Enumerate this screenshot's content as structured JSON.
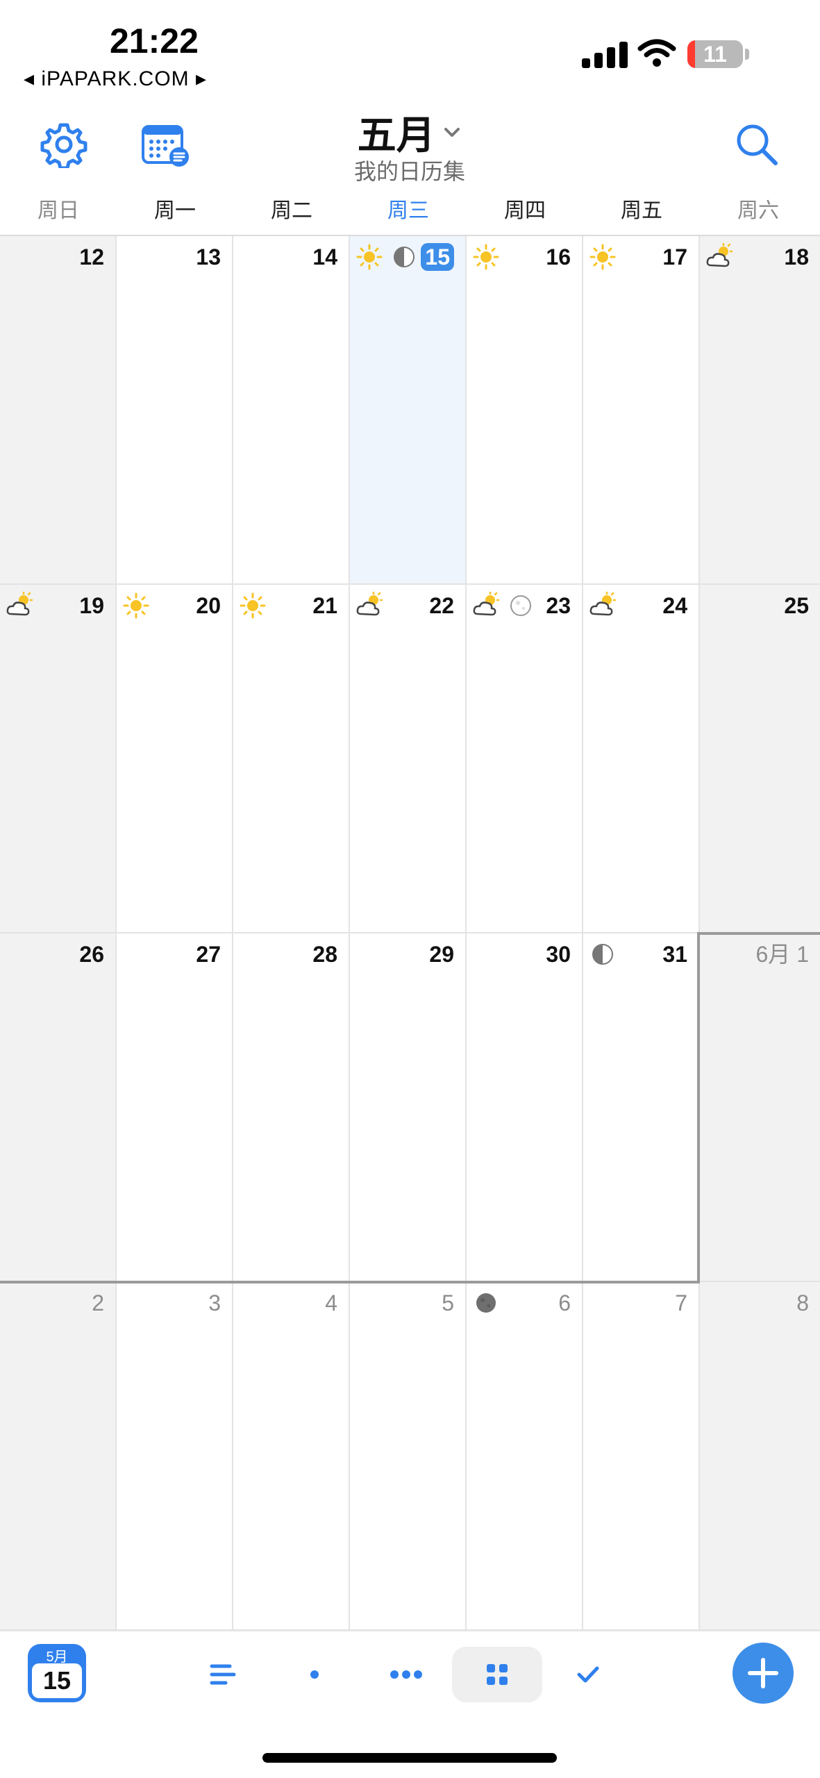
{
  "status_bar": {
    "time": "21:22",
    "back_label": "◂ iPAPARK.COM ▸",
    "battery": "11"
  },
  "header": {
    "title": "五月",
    "subtitle": "我的日历集",
    "settings_icon": "gear-icon",
    "calendars_icon": "calendar-list-icon",
    "search_icon": "search-icon"
  },
  "weekdays": [
    "周日",
    "周一",
    "周二",
    "周三",
    "周四",
    "周五",
    "周六"
  ],
  "calendar": {
    "rows": [
      [
        {
          "label": "12",
          "weekend": true
        },
        {
          "label": "13"
        },
        {
          "label": "14"
        },
        {
          "label": "15",
          "today": true,
          "icons": [
            "sun",
            "moon-half"
          ]
        },
        {
          "label": "16",
          "icons": [
            "sun"
          ]
        },
        {
          "label": "17",
          "icons": [
            "sun"
          ]
        },
        {
          "label": "18",
          "weekend": true,
          "icons": [
            "cloud-sun"
          ]
        }
      ],
      [
        {
          "label": "19",
          "weekend": true,
          "icons": [
            "cloud-sun"
          ]
        },
        {
          "label": "20",
          "icons": [
            "sun"
          ]
        },
        {
          "label": "21",
          "icons": [
            "sun"
          ]
        },
        {
          "label": "22",
          "icons": [
            "cloud-sun"
          ]
        },
        {
          "label": "23",
          "icons": [
            "cloud-sun",
            "moon-full"
          ]
        },
        {
          "label": "24",
          "icons": [
            "cloud-sun"
          ]
        },
        {
          "label": "25",
          "weekend": true
        }
      ],
      [
        {
          "label": "26",
          "weekend": true
        },
        {
          "label": "27"
        },
        {
          "label": "28"
        },
        {
          "label": "29"
        },
        {
          "label": "30"
        },
        {
          "label": "31",
          "icons": [
            "moon-half"
          ]
        },
        {
          "label": "6月 1",
          "weekend": true,
          "other": true
        }
      ],
      [
        {
          "label": "2",
          "weekend": true,
          "other": true
        },
        {
          "label": "3",
          "other": true
        },
        {
          "label": "4",
          "other": true
        },
        {
          "label": "5",
          "other": true
        },
        {
          "label": "6",
          "other": true,
          "icons": [
            "moon-new"
          ]
        },
        {
          "label": "7",
          "other": true
        },
        {
          "label": "8",
          "weekend": true,
          "other": true
        }
      ]
    ]
  },
  "toolbar": {
    "today_month": "5月",
    "today_day": "15",
    "views": [
      "list-view-icon",
      "day-view-icon",
      "multi-day-view-icon",
      "month-view-icon",
      "tasks-view-icon"
    ],
    "selected_view": 3,
    "add_icon": "plus-icon"
  },
  "colors": {
    "accent": "#2f80ed",
    "today_bg": "#eef5fd",
    "weekend_bg": "#f2f2f2",
    "sun": "#f7c325"
  }
}
